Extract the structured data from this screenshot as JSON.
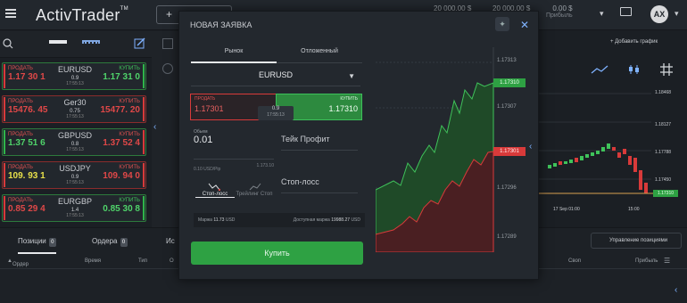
{
  "topbar": {
    "logo": "ActivTrader",
    "logo_tm": "TM",
    "new_order_btn": "+",
    "balances": [
      {
        "value": "20 000.00 $",
        "label": "Баланс"
      },
      {
        "value": "20 000.00 $",
        "label": "Маржа"
      },
      {
        "value": "0.00 $",
        "label": "Прибыль"
      }
    ],
    "avatar": "AX"
  },
  "left_panel": {
    "cards": [
      {
        "symbol": "EURUSD",
        "sell_label": "ПРОДАТЬ",
        "buy_label": "КУПИТЬ",
        "sell": "1.17 30 1",
        "buy": "1.17 31 0",
        "spread": "0.9",
        "time": "17:55:13",
        "style": "green"
      },
      {
        "symbol": "Ger30",
        "sell_label": "ПРОДАТЬ",
        "buy_label": "КУПИТЬ",
        "sell": "15476. 45",
        "buy": "15477. 20",
        "spread": "0.75",
        "time": "17:55:13",
        "style": "red"
      },
      {
        "symbol": "GBPUSD",
        "sell_label": "ПРОДАТЬ",
        "buy_label": "КУПИТЬ",
        "sell": "1.37 51 6",
        "buy": "1.37 52 4",
        "spread": "0.8",
        "time": "17:55:13",
        "style": "green"
      },
      {
        "symbol": "USDJPY",
        "sell_label": "ПРОДАТЬ",
        "buy_label": "КУПИТЬ",
        "sell": "109. 93 1",
        "buy": "109. 94 0",
        "spread": "0.9",
        "time": "17:55:13",
        "style": "red"
      },
      {
        "symbol": "EURGBP",
        "sell_label": "ПРОДАТЬ",
        "buy_label": "КУПИТЬ",
        "sell": "0.85 29 4",
        "buy": "0.85 30 8",
        "spread": "1.4",
        "time": "17:55:13",
        "style": "green"
      }
    ]
  },
  "modal": {
    "title": "НОВАЯ ЗАЯВКА",
    "tabs": [
      "Рынок",
      "Отложенный"
    ],
    "symbol": "EURUSD",
    "sell_label": "ПРОДАТЬ",
    "buy_label": "КУПИТЬ",
    "sell_price": "1.17301",
    "buy_price": "1.17310",
    "spread": "0.9",
    "time": "17:55:13",
    "volume_label": "Обьем",
    "volume_value": "0.01",
    "volume_hint_left": "0.10 USD/Pip",
    "volume_hint_right": "1.173.10",
    "take_profit": "Тейк Профит",
    "stop_options": [
      "Стоп-лосс",
      "Трейлинг Стоп"
    ],
    "stop_loss": "Стоп-лосс",
    "margin_label": "Маржа",
    "margin_value": "11.73",
    "margin_unit": "USD",
    "avail_label": "Доступная маржа",
    "avail_value": "19988.27",
    "avail_unit": "USD",
    "submit": "Купить",
    "chart": {
      "ticks": [
        "1.17313",
        "1.17307",
        "1.17296",
        "1.17289"
      ],
      "buy_marker": "1.17310",
      "sell_marker": "1.17301"
    }
  },
  "bottom": {
    "tabs": [
      {
        "label": "Позиции",
        "count": "0"
      },
      {
        "label": "Ордера",
        "count": "0"
      },
      {
        "label": "Ис"
      }
    ],
    "manage_label": "Управление позициями",
    "columns": [
      "Ордер",
      "Время",
      "Тип",
      "О",
      "Своп",
      "Прибыль"
    ]
  },
  "right": {
    "add_chart": "+ Добавить график",
    "ticks": [
      "1.18468",
      "1.18127",
      "1.17788",
      "1.17450"
    ],
    "price_marker": "1.17310",
    "date_label": "17 Sep 01:00",
    "time_label": "15:00",
    "left_date": "13"
  }
}
